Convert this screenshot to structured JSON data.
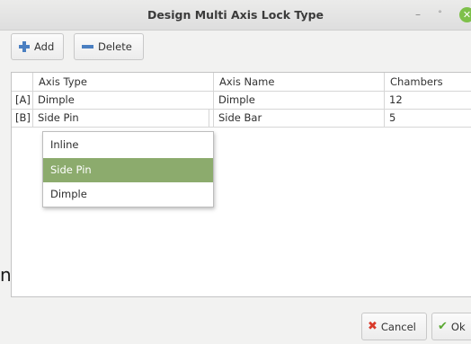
{
  "window": {
    "title": "Design Multi Axis Lock Type",
    "controls": {
      "minimize": "–",
      "maximize": "˚",
      "close": "✕"
    }
  },
  "toolbar": {
    "add_label": "Add",
    "delete_label": "Delete",
    "add_icon": "plus-icon",
    "delete_icon": "minus-icon"
  },
  "table": {
    "columns": [
      "",
      "Axis Type",
      "Axis Name",
      "Chambers"
    ],
    "rows": [
      {
        "index": "[A]",
        "axis_type": "Dimple",
        "axis_name": "Dimple",
        "chambers": "12"
      },
      {
        "index": "[B]",
        "axis_type": "Side Pin",
        "axis_name": "Side Bar",
        "chambers": "5"
      }
    ]
  },
  "dropdown": {
    "options": [
      "Inline",
      "Side Pin",
      "Dimple"
    ],
    "selected": "Side Pin",
    "arrow": "﹀"
  },
  "buttons": {
    "cancel_label": "Cancel",
    "ok_label": "Ok"
  },
  "stray_text": "n",
  "colors": {
    "selection": "#8cab6d",
    "accent_icon": "#4a7fc1",
    "cancel_icon": "#d93a2b",
    "ok_icon": "#5aa832",
    "close_button": "#7ec04a"
  }
}
